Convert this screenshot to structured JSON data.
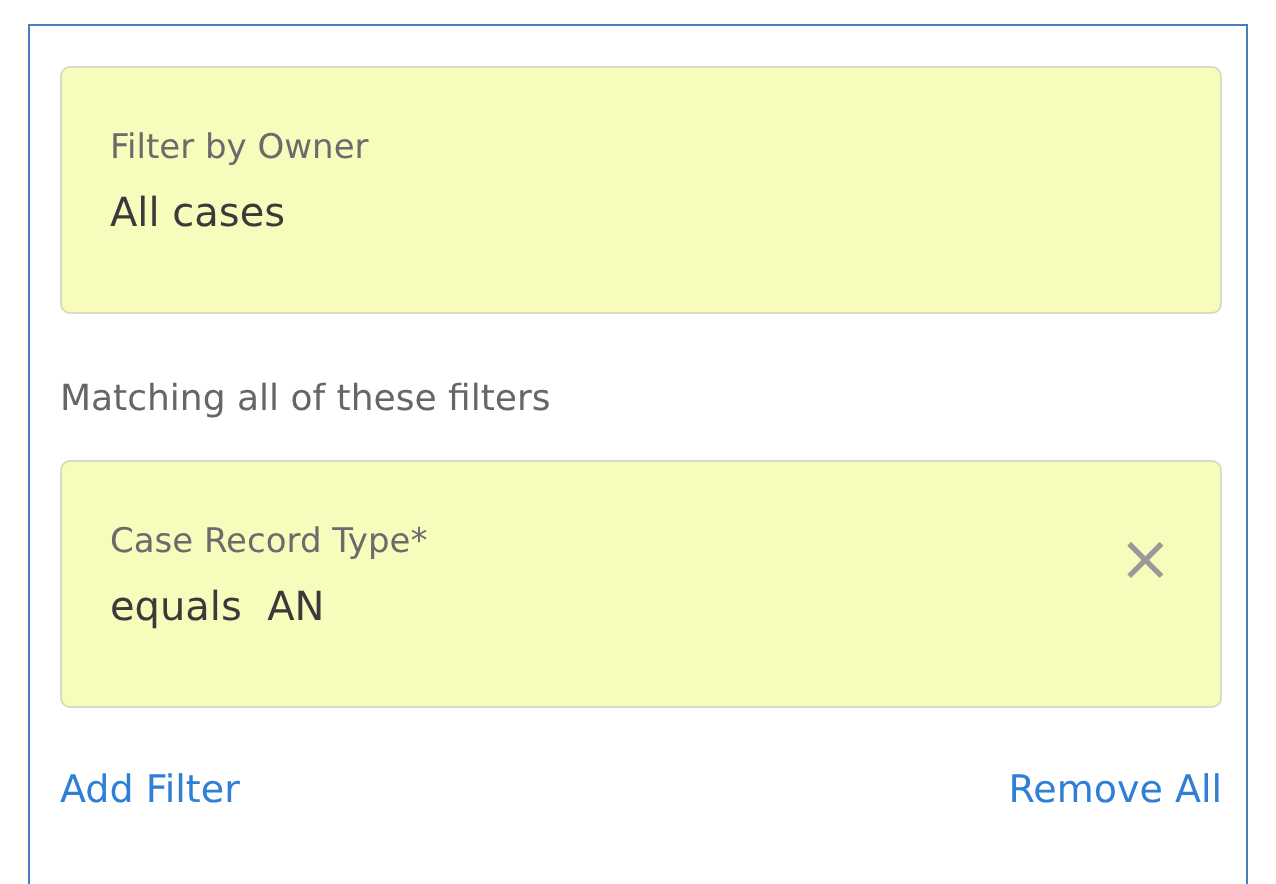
{
  "owner_filter": {
    "label": "Filter by Owner",
    "value": "All cases"
  },
  "section_label": "Matching all of these filters",
  "filters": [
    {
      "label": "Case Record Type*",
      "value": "equals  AN",
      "remove_icon": "×"
    }
  ],
  "actions": {
    "add": "Add Filter",
    "remove_all": "Remove All"
  }
}
